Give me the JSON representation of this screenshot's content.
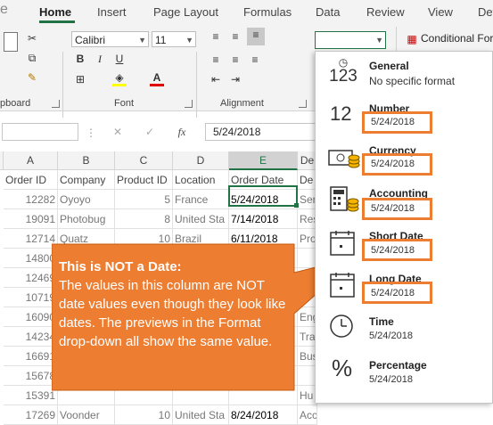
{
  "ribbon_tabs": [
    "Home",
    "Insert",
    "Page Layout",
    "Formulas",
    "Data",
    "Review",
    "View",
    "Dev"
  ],
  "font": {
    "name": "Calibri",
    "size": "11"
  },
  "groups": {
    "clipboard": "pboard",
    "font": "Font",
    "alignment": "Alignment"
  },
  "conditional_formatting_label": "Conditional For",
  "format_combo_value": "",
  "formula_bar": {
    "fx": "fx",
    "value": "5/24/2018"
  },
  "columns": [
    "A",
    "B",
    "C",
    "D",
    "E",
    "De"
  ],
  "rows": [
    [
      "Order ID",
      "Company",
      "Product ID",
      "Location",
      "Order Date",
      "De"
    ],
    [
      "12282",
      "Oyoyo",
      "5",
      "France",
      "5/24/2018",
      "Ser"
    ],
    [
      "19091",
      "Photobug",
      "8",
      "United Sta",
      "7/14/2018",
      "Res"
    ],
    [
      "12714",
      "Quatz",
      "10",
      "Brazil",
      "6/11/2018",
      "Pro"
    ],
    [
      "14800",
      "",
      "",
      "",
      "",
      ""
    ],
    [
      "12469",
      "",
      "",
      "",
      "",
      ""
    ],
    [
      "10719",
      "",
      "",
      "",
      "",
      ""
    ],
    [
      "16090",
      "",
      "",
      "",
      "",
      "Eng"
    ],
    [
      "14234",
      "",
      "",
      "",
      "",
      "Tra"
    ],
    [
      "16691",
      "",
      "",
      "",
      "",
      "Bus"
    ],
    [
      "15678",
      "",
      "",
      "",
      "",
      ""
    ],
    [
      "15391",
      "",
      "",
      "",
      "",
      "Hu"
    ],
    [
      "17269",
      "Voonder",
      "10",
      "United Sta",
      "8/24/2018",
      "Acc"
    ]
  ],
  "formats": [
    {
      "name": "General",
      "sample": "No specific format",
      "icon": "general-icon"
    },
    {
      "name": "Number",
      "sample": "5/24/2018",
      "icon": "number-icon"
    },
    {
      "name": "Currency",
      "sample": "5/24/2018",
      "icon": "currency-icon"
    },
    {
      "name": "Accounting",
      "sample": "5/24/2018",
      "icon": "accounting-icon"
    },
    {
      "name": "Short Date",
      "sample": "5/24/2018",
      "icon": "short-date-icon"
    },
    {
      "name": "Long Date",
      "sample": "5/24/2018",
      "icon": "long-date-icon"
    },
    {
      "name": "Time",
      "sample": "5/24/2018",
      "icon": "clock-icon"
    },
    {
      "name": "Percentage",
      "sample": "5/24/2018",
      "icon": "percent-icon"
    }
  ],
  "callout": {
    "title": "This is NOT a Date:",
    "body": "The values in this column are NOT date values even though they look like dates.  The previews in the Format drop-down all show the same value."
  },
  "colors": {
    "accent": "#217346",
    "callout": "#ed7d31"
  }
}
